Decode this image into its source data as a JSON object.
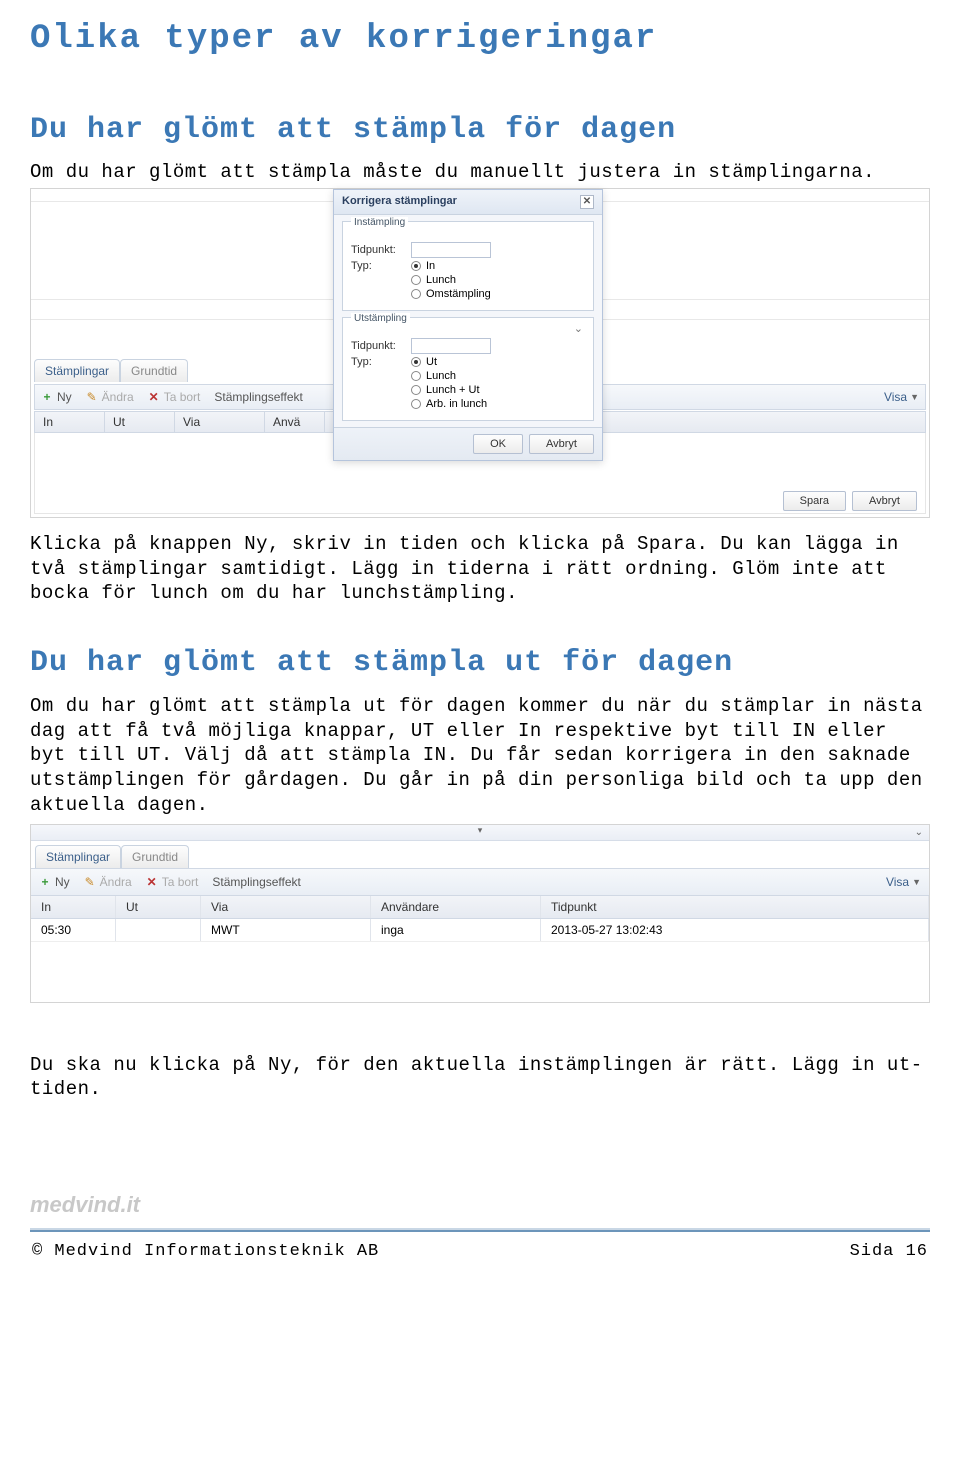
{
  "page_title": "Olika typer av korrigeringar",
  "section1": {
    "title": "Du har glömt att stämpla för dagen",
    "intro": "Om du har glömt att stämpla måste du manuellt justera in stämplingarna.",
    "after": "Klicka på knappen Ny, skriv in tiden och klicka på Spara. Du kan lägga in två stämplingar samtidigt. Lägg in tiderna i rätt ordning. Glöm inte att bocka för lunch om du har lunchstämpling."
  },
  "screenshot1": {
    "tabs": [
      "Stämplingar",
      "Grundtid"
    ],
    "toolbar": {
      "ny": "Ny",
      "andra": "Ändra",
      "tabort": "Ta bort",
      "effekt": "Stämplingseffekt",
      "visa": "Visa"
    },
    "columns": [
      "In",
      "Ut",
      "Via",
      "Anvä"
    ],
    "right_buttons": [
      "Spara",
      "Avbryt"
    ],
    "dialog": {
      "title": "Korrigera stämplingar",
      "group1": {
        "legend": "Instämpling",
        "tidpunkt_label": "Tidpunkt:",
        "typ_label": "Typ:",
        "opts": [
          "In",
          "Lunch",
          "Omstämpling"
        ],
        "selected": 0
      },
      "group2": {
        "legend": "Utstämpling",
        "tidpunkt_label": "Tidpunkt:",
        "typ_label": "Typ:",
        "opts": [
          "Ut",
          "Lunch",
          "Lunch + Ut",
          "Arb. in lunch"
        ],
        "selected": 0
      },
      "ok": "OK",
      "avbryt": "Avbryt"
    }
  },
  "section2": {
    "title": "Du har glömt att stämpla ut för dagen",
    "body": "Om du har glömt att stämpla ut för dagen kommer du när du stämplar in nästa dag att få två möjliga knappar, UT eller In respektive byt till IN eller byt till UT. Välj då att stämpla IN. Du får sedan korrigera in den saknade utstämplingen för gårdagen. Du går in på din personliga bild och ta upp den aktuella dagen."
  },
  "screenshot2": {
    "tabs": [
      "Stämplingar",
      "Grundtid"
    ],
    "toolbar": {
      "ny": "Ny",
      "andra": "Ändra",
      "tabort": "Ta bort",
      "effekt": "Stämplingseffekt",
      "visa": "Visa"
    },
    "columns": {
      "in": "In",
      "ut": "Ut",
      "via": "Via",
      "anvandare": "Användare",
      "tidpunkt": "Tidpunkt"
    },
    "rows": [
      {
        "in": "05:30",
        "ut": "",
        "via": "MWT",
        "anvandare": "inga",
        "tidpunkt": "2013-05-27 13:02:43"
      }
    ]
  },
  "closing": "Du ska nu klicka på Ny, för den aktuella instämplingen är rätt. Lägg in ut-tiden.",
  "brand": "medvind.it",
  "footer": {
    "left": "©  Medvind Informationsteknik AB",
    "right": "Sida 16"
  }
}
